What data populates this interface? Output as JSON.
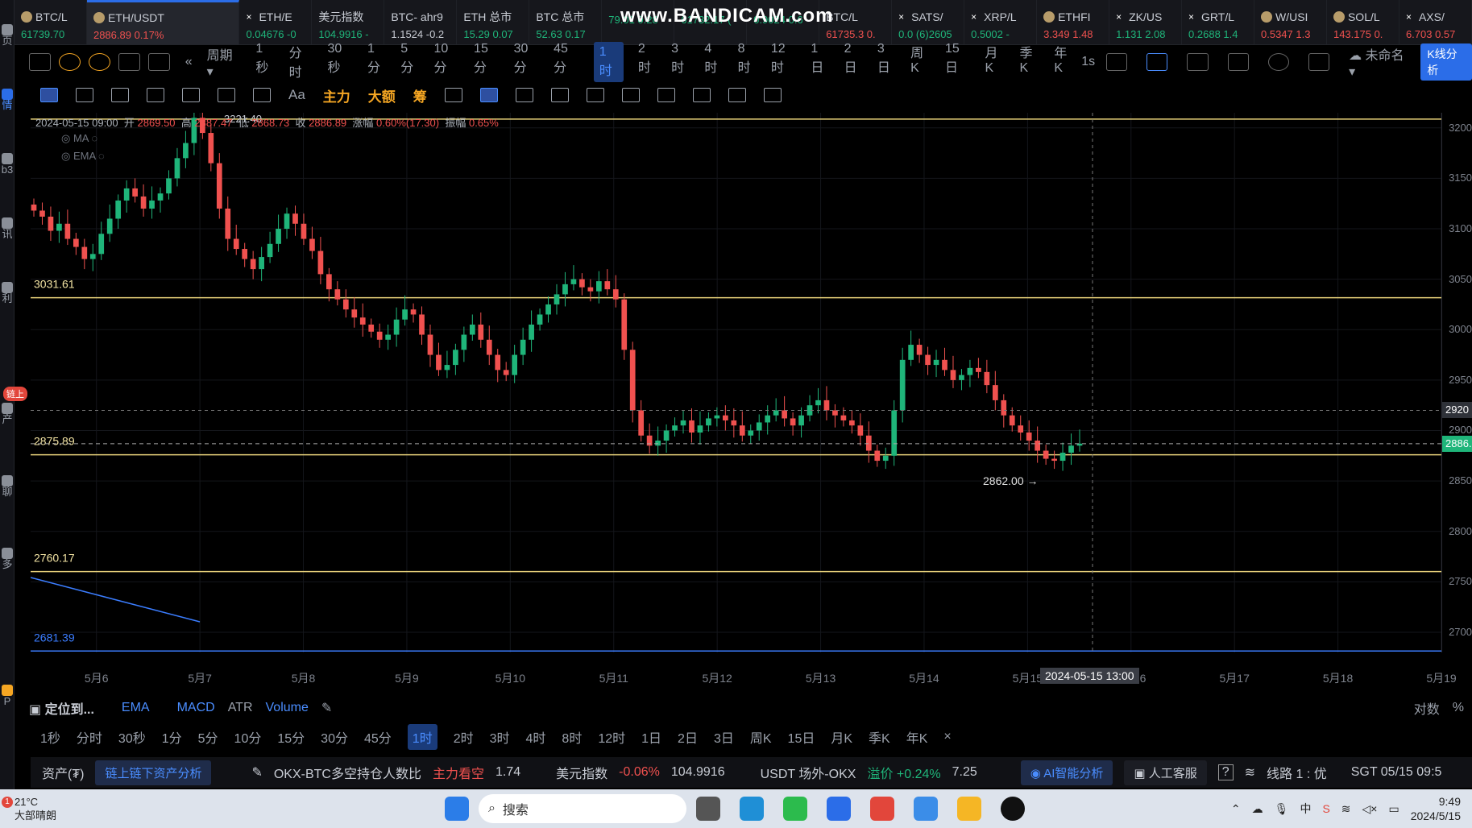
{
  "watermark": "www.BANDICAM.com",
  "left_rail": {
    "labels": [
      "页",
      "情",
      "b3",
      "讯",
      "利",
      "产",
      "聊",
      "多",
      "P"
    ],
    "badge": "链上"
  },
  "tabs": [
    {
      "name": "BTC/L",
      "value": "61739.70",
      "color": "#1fb57a",
      "icon": "coin"
    },
    {
      "name": "ETH/USDT",
      "value": "2886.89  0.17%",
      "color": "#f0514f",
      "icon": "coin",
      "active": true
    },
    {
      "name": "ETH/E",
      "value": "0.04676  -0",
      "color": "#1fb57a",
      "icon": "cross"
    },
    {
      "name": "美元指数",
      "value": "104.9916  -",
      "color": "#1fb57a",
      "icon": ""
    },
    {
      "name": "BTC- ahr9",
      "value": "1.1524  -0.2",
      "color": "#c8ccd4",
      "icon": ""
    },
    {
      "name": "ETH 总市",
      "value": "15.29  0.07",
      "color": "#1fb57a",
      "icon": ""
    },
    {
      "name": "BTC 总市",
      "value": "52.63  0.17",
      "color": "#1fb57a",
      "icon": ""
    },
    {
      "name": "",
      "value": "79.01  0.28",
      "color": "#1fb57a",
      "icon": ""
    },
    {
      "name": "",
      "value": "61732.17  (",
      "color": "#1fb57a",
      "icon": ""
    },
    {
      "name": "",
      "value": "0.9024  0.6",
      "color": "#1fb57a",
      "icon": ""
    },
    {
      "name": "BTC/L",
      "value": "61735.3  0.",
      "color": "#f0514f",
      "icon": ""
    },
    {
      "name": "SATS/",
      "value": "0.0 (6)2605",
      "color": "#1fb57a",
      "icon": "cross"
    },
    {
      "name": "XRP/L",
      "value": "0.5002  -",
      "color": "#1fb57a",
      "icon": "cross"
    },
    {
      "name": "ETHFI",
      "value": "3.349  1.48",
      "color": "#f0514f",
      "icon": "coin"
    },
    {
      "name": "ZK/US",
      "value": "1.131  2.08",
      "color": "#1fb57a",
      "icon": "cross"
    },
    {
      "name": "GRT/L",
      "value": "0.2688  1.4",
      "color": "#1fb57a",
      "icon": "cross"
    },
    {
      "name": "W/USI",
      "value": "0.5347  1.3",
      "color": "#f0514f",
      "icon": "coin"
    },
    {
      "name": "SOL/L",
      "value": "143.175  0.",
      "color": "#f0514f",
      "icon": "coin"
    },
    {
      "name": "AXS/",
      "value": "6.703  0.57",
      "color": "#f0514f",
      "icon": "cross"
    }
  ],
  "toolbar1": {
    "period_label": "周期",
    "periods": [
      "1秒",
      "分时",
      "30秒",
      "1分",
      "5分",
      "10分",
      "15分",
      "30分",
      "45分",
      "1时",
      "2时",
      "3时",
      "4时",
      "8时",
      "12时",
      "1日",
      "2日",
      "3日",
      "周K",
      "15日",
      "月K",
      "季K",
      "年K"
    ],
    "selected": "1时",
    "right_interval": "1s",
    "layout_name": "未命名",
    "kline_analysis": "K线分析"
  },
  "toolbar2": {
    "labels": [
      "Aa",
      "主力",
      "大额",
      "筹"
    ]
  },
  "chart_info": {
    "datetime": "2024-05-15 09:00",
    "open_label": "开",
    "open": "2869.50",
    "high_label": "高",
    "high": "2887.47",
    "low_label": "低",
    "low": "2868.73",
    "close_label": "收",
    "close": "2886.89",
    "change_label": "涨幅",
    "change": "0.60%(17.30)",
    "amp_label": "振幅",
    "amp": "0.65%",
    "ma_label": "MA",
    "ema_label": "EMA"
  },
  "chart_data": {
    "type": "candlestick",
    "symbol": "ETH/USDT",
    "interval": "1时",
    "x_ticks": [
      "5月6",
      "5月7",
      "5月8",
      "5月9",
      "5月10",
      "5月11",
      "5月12",
      "5月13",
      "5月14",
      "5月15",
      "5月16",
      "5月17",
      "5月18",
      "5月19"
    ],
    "hover_x": "2024-05-15 13:00",
    "y_ticks": [
      "3200",
      "3150",
      "3100",
      "3050",
      "3000",
      "2950",
      "2900",
      "2850",
      "2800",
      "2750",
      "2700"
    ],
    "ylim": [
      2680,
      3215
    ],
    "horizontal_lines": [
      {
        "value": 3208.75,
        "label": "3208.75",
        "color": "#e8d27a"
      },
      {
        "value": 3031.61,
        "label": "3031.61",
        "color": "#e8d27a"
      },
      {
        "value": 2875.89,
        "label": "2875.89",
        "color": "#e8d27a"
      },
      {
        "value": 2760.17,
        "label": "2760.17",
        "color": "#e8d27a"
      },
      {
        "value": 2681.39,
        "label": "2681.39",
        "color": "#3b7dff"
      }
    ],
    "high_marker": "3221.40",
    "low_marker": "2862.00 →",
    "last_price": "2886.89",
    "crosshair_price": "2920",
    "closes": [
      3118,
      3112,
      3098,
      3105,
      3090,
      3082,
      3070,
      3075,
      3095,
      3110,
      3128,
      3140,
      3132,
      3120,
      3128,
      3135,
      3150,
      3170,
      3185,
      3210,
      3195,
      3165,
      3120,
      3090,
      3080,
      3070,
      3060,
      3072,
      3085,
      3100,
      3115,
      3105,
      3090,
      3078,
      3055,
      3040,
      3030,
      3020,
      3012,
      3005,
      2998,
      2990,
      2995,
      3010,
      3020,
      3015,
      2995,
      2975,
      2960,
      2965,
      2980,
      2995,
      3005,
      2990,
      2975,
      2960,
      2955,
      2975,
      2990,
      3005,
      3015,
      3025,
      3035,
      3045,
      3050,
      3042,
      3038,
      3048,
      3040,
      3030,
      2980,
      2920,
      2895,
      2885,
      2890,
      2900,
      2905,
      2910,
      2898,
      2905,
      2912,
      2915,
      2910,
      2905,
      2895,
      2900,
      2908,
      2915,
      2920,
      2912,
      2905,
      2915,
      2925,
      2930,
      2920,
      2915,
      2910,
      2905,
      2895,
      2880,
      2870,
      2875,
      2920,
      2970,
      2985,
      2975,
      2965,
      2970,
      2960,
      2950,
      2955,
      2962,
      2958,
      2945,
      2930,
      2915,
      2905,
      2898,
      2890,
      2880,
      2872,
      2870,
      2878,
      2885,
      2887
    ],
    "hover_close": "2886.89"
  },
  "bottom_bar1": {
    "locate": "定位到...",
    "indicators": [
      "EMA",
      "MACD",
      "ATR",
      "Volume"
    ],
    "right": [
      "对数",
      "%"
    ]
  },
  "bottom_bar2": {
    "periods": [
      "1秒",
      "分时",
      "30秒",
      "1分",
      "5分",
      "10分",
      "15分",
      "30分",
      "45分",
      "1时",
      "2时",
      "3时",
      "4时",
      "8时",
      "12时",
      "1日",
      "2日",
      "3日",
      "周K",
      "15日",
      "月K",
      "季K",
      "年K"
    ],
    "selected": "1时"
  },
  "status_bar": {
    "assets": "资产(₮)",
    "asset_analysis": "链上链下资产分析",
    "ratio_label": "OKX-BTC多空持仓人数比",
    "ratio_tag": "主力看空",
    "ratio_value": "1.74",
    "dxy_label": "美元指数",
    "dxy_change": "-0.06%",
    "dxy_value": "104.9916",
    "otc_label": "USDT 场外-OKX",
    "otc_premium": "溢价 +0.24%",
    "otc_value": "7.25",
    "ai": "AI智能分析",
    "support": "人工客服",
    "line": "线路 1 : 优",
    "clock": "SGT 05/15 09:5"
  },
  "taskbar": {
    "weather_temp": "21°C",
    "weather_desc": "大部晴朗",
    "weather_badge": "1",
    "search": "搜索",
    "time": "9:49",
    "date": "2024/5/15"
  }
}
